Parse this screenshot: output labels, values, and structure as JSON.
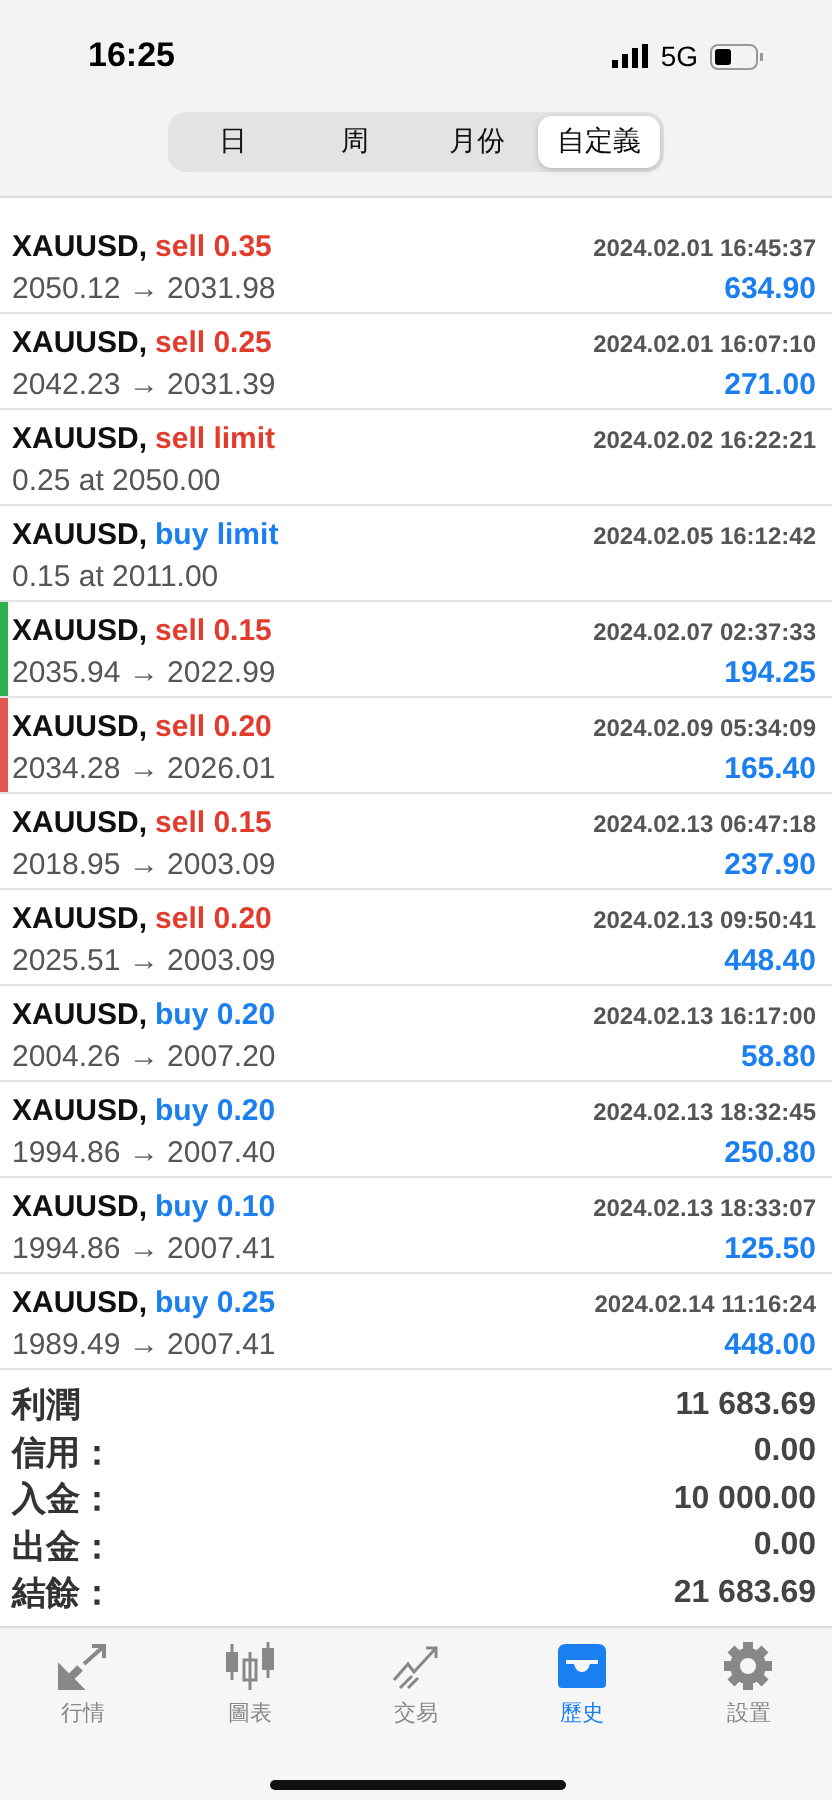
{
  "status_bar": {
    "time": "16:25",
    "network": "5G"
  },
  "period_tabs": [
    {
      "label": "日",
      "selected": false
    },
    {
      "label": "周",
      "selected": false
    },
    {
      "label": "月份",
      "selected": false
    },
    {
      "label": "自定義",
      "selected": true
    }
  ],
  "orders": [
    {
      "symbol": "XAUUSD,",
      "kind": "sell",
      "order": "sell 0.35",
      "time": "2024.02.01 16:45:37",
      "detail": "2050.12 → 2031.98",
      "profit": "634.90"
    },
    {
      "symbol": "XAUUSD,",
      "kind": "sell",
      "order": "sell 0.25",
      "time": "2024.02.01 16:07:10",
      "detail": "2042.23 → 2031.39",
      "profit": "271.00"
    },
    {
      "symbol": "XAUUSD,",
      "kind": "sell",
      "order": "sell limit",
      "time": "2024.02.02 16:22:21",
      "detail": "0.25 at 2050.00"
    },
    {
      "symbol": "XAUUSD,",
      "kind": "buy",
      "order": "buy limit",
      "time": "2024.02.05 16:12:42",
      "detail": "0.15 at 2011.00"
    },
    {
      "symbol": "XAUUSD,",
      "kind": "sell",
      "order": "sell 0.15",
      "time": "2024.02.07 02:37:33",
      "detail": "2035.94 → 2022.99",
      "profit": "194.25",
      "color": "#2bb24c"
    },
    {
      "symbol": "XAUUSD,",
      "kind": "sell",
      "order": "sell 0.20",
      "time": "2024.02.09 05:34:09",
      "detail": "2034.28 → 2026.01",
      "profit": "165.40",
      "color": "#e0574f"
    },
    {
      "symbol": "XAUUSD,",
      "kind": "sell",
      "order": "sell 0.15",
      "time": "2024.02.13 06:47:18",
      "detail": "2018.95 → 2003.09",
      "profit": "237.90"
    },
    {
      "symbol": "XAUUSD,",
      "kind": "sell",
      "order": "sell 0.20",
      "time": "2024.02.13 09:50:41",
      "detail": "2025.51 → 2003.09",
      "profit": "448.40"
    },
    {
      "symbol": "XAUUSD,",
      "kind": "buy",
      "order": "buy 0.20",
      "time": "2024.02.13 16:17:00",
      "detail": "2004.26 → 2007.20",
      "profit": "58.80"
    },
    {
      "symbol": "XAUUSD,",
      "kind": "buy",
      "order": "buy 0.20",
      "time": "2024.02.13 18:32:45",
      "detail": "1994.86 → 2007.40",
      "profit": "250.80"
    },
    {
      "symbol": "XAUUSD,",
      "kind": "buy",
      "order": "buy 0.10",
      "time": "2024.02.13 18:33:07",
      "detail": "1994.86 → 2007.41",
      "profit": "125.50"
    },
    {
      "symbol": "XAUUSD,",
      "kind": "buy",
      "order": "buy 0.25",
      "time": "2024.02.14 11:16:24",
      "detail": "1989.49 → 2007.41",
      "profit": "448.00"
    }
  ],
  "summary": [
    {
      "label": "利潤",
      "value": "11 683.69"
    },
    {
      "label": "信用：",
      "value": "0.00"
    },
    {
      "label": "入金：",
      "value": "10 000.00"
    },
    {
      "label": "出金：",
      "value": "0.00"
    },
    {
      "label": "結餘：",
      "value": "21 683.69"
    }
  ],
  "nav": [
    {
      "kind": "quotes",
      "label": "行情",
      "selected": false
    },
    {
      "kind": "chart",
      "label": "圖表",
      "selected": false
    },
    {
      "kind": "trade",
      "label": "交易",
      "selected": false
    },
    {
      "kind": "history",
      "label": "歷史",
      "selected": true
    },
    {
      "kind": "settings",
      "label": "設置",
      "selected": false
    }
  ]
}
